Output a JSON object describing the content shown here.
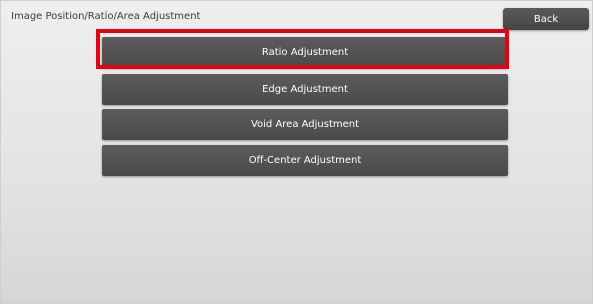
{
  "header": {
    "title": "Image Position/Ratio/Area Adjustment",
    "back_label": "Back"
  },
  "menu": {
    "items": [
      {
        "label": "Ratio Adjustment"
      },
      {
        "label": "Edge Adjustment"
      },
      {
        "label": "Void Area Adjustment"
      },
      {
        "label": "Off-Center Adjustment"
      }
    ]
  },
  "colors": {
    "highlight": "#e60012",
    "button": "#4f4f4f",
    "background": "#e6e6e6"
  }
}
